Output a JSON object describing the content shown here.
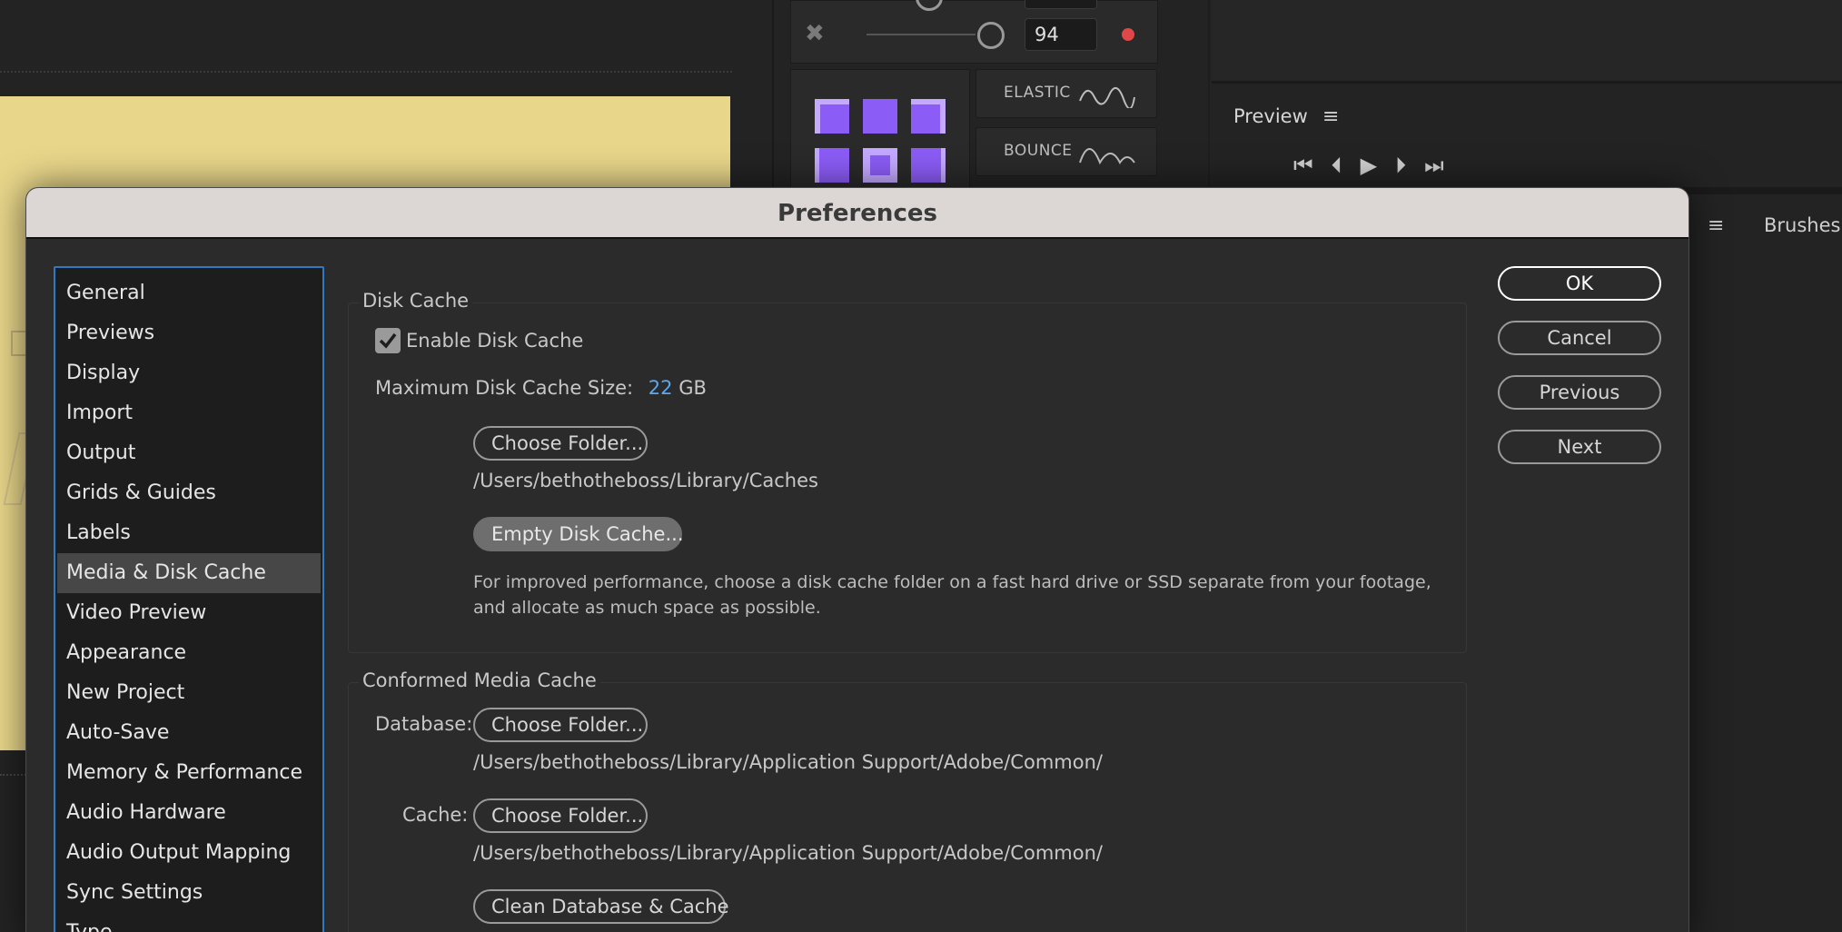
{
  "background": {
    "ease_value": "94",
    "ease_options": [
      "ELASTIC",
      "BOUNCE"
    ],
    "preview_title": "Preview",
    "brushes_tab": "Brushes"
  },
  "dialog": {
    "title": "Preferences",
    "nav_items": [
      "General",
      "Previews",
      "Display",
      "Import",
      "Output",
      "Grids & Guides",
      "Labels",
      "Media & Disk Cache",
      "Video Preview",
      "Appearance",
      "New Project",
      "Auto-Save",
      "Memory & Performance",
      "Audio Hardware",
      "Audio Output Mapping",
      "Sync Settings",
      "Type"
    ],
    "active_nav": "Media & Disk Cache",
    "buttons": {
      "ok": "OK",
      "cancel": "Cancel",
      "previous": "Previous",
      "next": "Next"
    },
    "disk_cache": {
      "title": "Disk Cache",
      "enable_label": "Enable Disk Cache",
      "enabled": true,
      "max_size_label": "Maximum Disk Cache Size:",
      "max_size_value": "22",
      "max_size_unit": "GB",
      "choose_folder": "Choose Folder...",
      "folder_path": "/Users/bethotheboss/Library/Caches",
      "empty_cache": "Empty Disk Cache...",
      "help_text": "For improved performance, choose a disk cache folder on a fast hard drive or SSD separate from your footage, and allocate as much space as possible."
    },
    "conformed": {
      "title": "Conformed Media Cache",
      "database_label": "Database:",
      "database_button": "Choose Folder...",
      "database_path": "/Users/bethotheboss/Library/Application Support/Adobe/Common/",
      "cache_label": "Cache:",
      "cache_button": "Choose Folder...",
      "cache_path": "/Users/bethotheboss/Library/Application Support/Adobe/Common/",
      "clean_button": "Clean Database & Cache"
    }
  },
  "colors": {
    "accent_blue": "#5aa8f0",
    "nav_border": "#2f78c4",
    "red_dot": "#e04848",
    "purple": "#8b5cf6"
  }
}
